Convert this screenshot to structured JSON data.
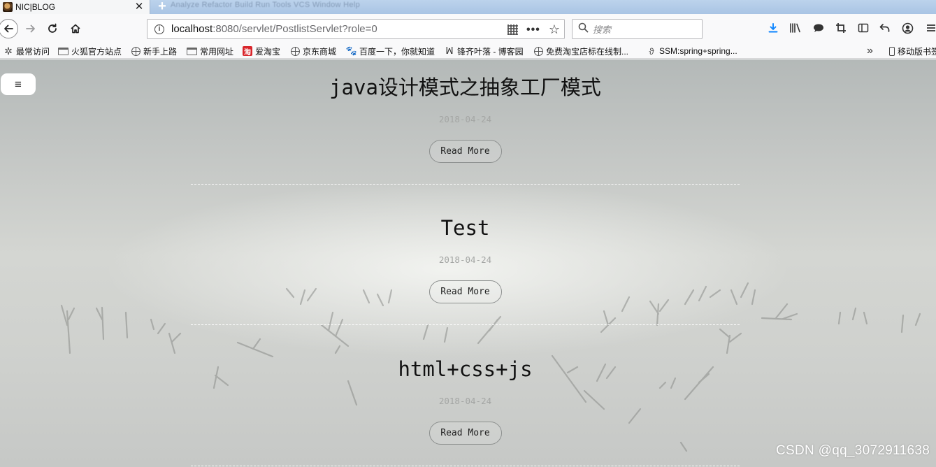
{
  "browser": {
    "tab": {
      "title": "NIC|BLOG",
      "close": "✕"
    },
    "new_tab": "+",
    "ghost_menu": "Analyze  Refactor  Build  Run  Tools  VCS  Window  Help",
    "url": {
      "host": "localhost",
      "rest": ":8080/servlet/PostlistServlet?role=0"
    },
    "url_icons": {
      "info": "i",
      "dots": "•••",
      "star": "☆"
    },
    "search": {
      "placeholder": "搜索"
    },
    "toolbar_icons": [
      "download-icon",
      "library-icon",
      "chat-icon",
      "screenshot-icon",
      "sidebar-icon",
      "undo-icon",
      "account-icon",
      "menu-icon"
    ],
    "bookmarks": [
      {
        "label": "最常访问",
        "icon": "gear-icon"
      },
      {
        "label": "火狐官方站点",
        "icon": "folder-icon"
      },
      {
        "label": "新手上路",
        "icon": "globe-icon"
      },
      {
        "label": "常用网址",
        "icon": "folder-icon"
      },
      {
        "label": "爱淘宝",
        "icon": "taobao-icon"
      },
      {
        "label": "京东商城",
        "icon": "globe-icon"
      },
      {
        "label": "百度一下，你就知道",
        "icon": "baidu-paw-icon"
      },
      {
        "label": "锋齐叶落 - 博客园",
        "icon": "blog-icon"
      },
      {
        "label": "免费淘宝店标在线制...",
        "icon": "globe-icon"
      },
      {
        "label": "SSM:spring+spring...",
        "icon": "csdn-icon"
      }
    ],
    "bookmarks_more": "»",
    "mobile_bookmarks": "移动版书签"
  },
  "page": {
    "menu_button": "≡",
    "posts": [
      {
        "title": "java设计模式之抽象工厂模式",
        "date": "2018-04-24",
        "button": "Read More"
      },
      {
        "title": "Test",
        "date": "2018-04-24",
        "button": "Read More"
      },
      {
        "title": "html+css+js",
        "date": "2018-04-24",
        "button": "Read More"
      }
    ],
    "watermark": "CSDN @qq_3072911638"
  }
}
